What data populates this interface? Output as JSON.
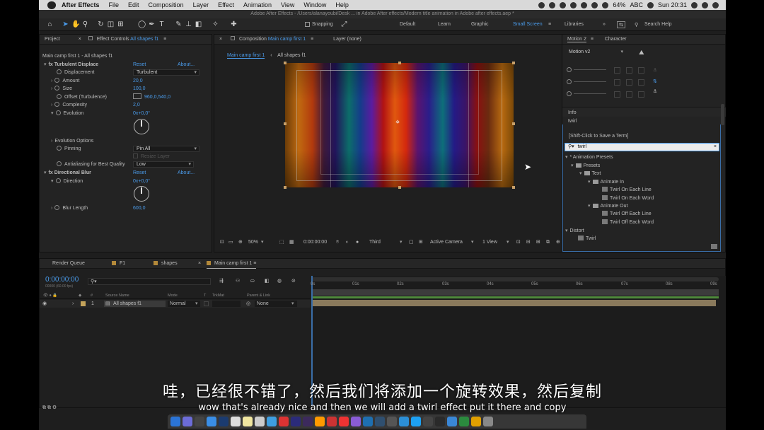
{
  "menubar": {
    "app_name": "After Effects",
    "items": [
      "File",
      "Edit",
      "Composition",
      "Layer",
      "Effect",
      "Animation",
      "View",
      "Window",
      "Help"
    ],
    "status": {
      "pct": "64%",
      "input": "ABC",
      "time": "Sun 20:31"
    }
  },
  "window_title": "Adobe After Effects - /Users/alanayoubi/Desk ... in Adobe After effects/Modern title animation in Adobe after effects.aep *",
  "toolbar": {
    "snapping": "Snapping",
    "workspaces": [
      "Default",
      "Learn",
      "Graphic",
      "Small Screen",
      "Libraries"
    ],
    "active_workspace": "Small Screen",
    "search_help": "Search Help"
  },
  "project_panel": {
    "tab": "Project"
  },
  "effect_controls": {
    "tab_prefix": "Effect Controls",
    "tab_layer": "All shapes f1",
    "layer_path": "Main camp first 1 - All shapes f1",
    "turbulent_displace": {
      "name": "Turbulent Displace",
      "reset": "Reset",
      "about": "About...",
      "displacement_label": "Displacement",
      "displacement_value": "Turbulent",
      "amount_label": "Amount",
      "amount_value": "20,0",
      "size_label": "Size",
      "size_value": "100,0",
      "offset_label": "Offset (Turbulence)",
      "offset_value": "960,0,540,0",
      "complexity_label": "Complexity",
      "complexity_value": "2,0",
      "evolution_label": "Evolution",
      "evolution_value": "0x+0,0°",
      "evolution_options": "Evolution Options",
      "pinning_label": "Pinning",
      "pinning_value": "Pin All",
      "resize_layer": "Resize Layer",
      "antialiasing_label": "Antialiasing for Best Quality",
      "antialiasing_value": "Low"
    },
    "directional_blur": {
      "name": "Directional Blur",
      "reset": "Reset",
      "about": "About...",
      "direction_label": "Direction",
      "direction_value": "0x+0,0°",
      "blur_label": "Blur Length",
      "blur_value": "600,0"
    }
  },
  "composition": {
    "tab_prefix": "Composition",
    "tab_name": "Main camp first 1",
    "layer_tab": "Layer (none)",
    "breadcrumbs": [
      "Main camp first 1",
      "All shapes f1"
    ],
    "footer": {
      "zoom": "50%",
      "timecode": "0:00:00:00",
      "resolution": "Third",
      "camera": "Active Camera",
      "view": "1 View"
    }
  },
  "right_panel": {
    "tabs": [
      "Motion 2",
      "Character"
    ],
    "motion_version": "Motion v2",
    "info_tab": "Info",
    "info_value": "twirl",
    "save_hint": "[Shift-Click to Save a Term]",
    "search_value": "twirl",
    "tree": [
      {
        "label": "* Animation Presets",
        "kind": "root"
      },
      {
        "label": "Presets",
        "kind": "folder"
      },
      {
        "label": "Text",
        "kind": "folder"
      },
      {
        "label": "Animate In",
        "kind": "folder"
      },
      {
        "label": "Twirl On Each Line",
        "kind": "preset"
      },
      {
        "label": "Twirl On Each Word",
        "kind": "preset"
      },
      {
        "label": "Animate Out",
        "kind": "folder"
      },
      {
        "label": "Twirl Off Each Line",
        "kind": "preset"
      },
      {
        "label": "Twirl Off Each Word",
        "kind": "preset"
      },
      {
        "label": "Distort",
        "kind": "root"
      },
      {
        "label": "Twirl",
        "kind": "preset"
      }
    ]
  },
  "timeline": {
    "tabs": [
      "Render Queue",
      "F1",
      "shapes",
      "Main camp first 1"
    ],
    "active_tab": "Main camp first 1",
    "timecode": "0:00:00:00",
    "fps": "00000 (60.00 fps)",
    "columns": {
      "hash": "#",
      "source": "Source Name",
      "mode": "Mode",
      "t": "T",
      "trkmat": "TrkMat",
      "parent": "Parent & Link"
    },
    "layer": {
      "number": "1",
      "name": "All shapes f1",
      "mode": "Normal",
      "parent": "None"
    },
    "ruler": [
      "0s",
      "01s",
      "02s",
      "03s",
      "04s",
      "05s",
      "06s",
      "07s",
      "08s",
      "09s"
    ]
  },
  "subtitles": {
    "chinese": "哇，已经很不错了，然后我们将添加一个旋转效果，然后复制",
    "english": "wow that's already nice and then we will add a twirl effect put it there and copy"
  },
  "colors": {
    "accent": "#4a9bea",
    "layer_bar": "#8a7a5c",
    "label_yellow": "#b3893a"
  }
}
